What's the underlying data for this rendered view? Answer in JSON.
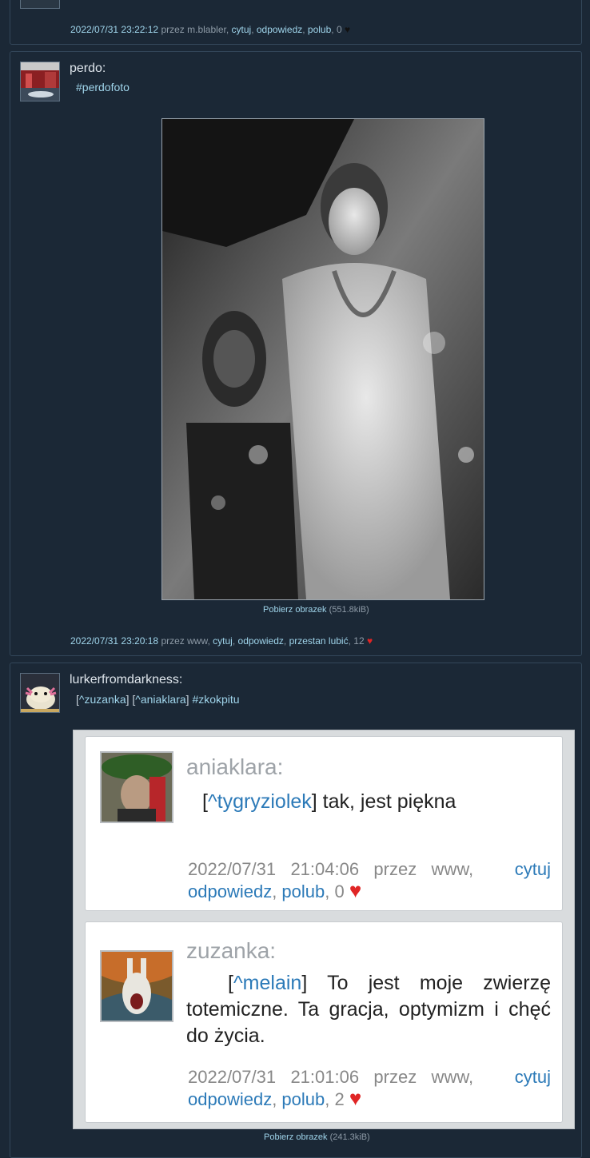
{
  "post0": {
    "timestamp": "2022/07/31 23:22:12",
    "via_prefix": "przez",
    "via": "m.blabler",
    "quote": "cytuj",
    "reply": "odpowiedz",
    "like": "polub",
    "likes": "0",
    "heart": "♥"
  },
  "post1": {
    "author": "perdo:",
    "tag": "#perdofoto",
    "download_label": "Pobierz obrazek",
    "download_size": "(551.8kiB)",
    "timestamp": "2022/07/31 23:20:18",
    "via_prefix": "przez",
    "via": "www",
    "quote": "cytuj",
    "reply": "odpowiedz",
    "unlike": "przestan lubić",
    "likes": "12",
    "heart": "♥"
  },
  "post2": {
    "author": "lurkerfromdarkness:",
    "mention1": "^zuzanka",
    "mention2": "^aniaklara",
    "tag": "#zkokpitu",
    "download_label": "Pobierz obrazek",
    "download_size": "(241.3kiB)",
    "cards": [
      {
        "author": "aniaklara:",
        "mention": "^tygryziolek",
        "text": " tak, jest piękna",
        "meta_prefix": "2022/07/31   21:04:06   przez   www,",
        "quote": "cytuj",
        "reply": "odpowiedz",
        "like": "polub",
        "likes": "0",
        "heart": "♥"
      },
      {
        "author": "zuzanka:",
        "mention": "^melain",
        "text": " To jest moje zwierzę totemiczne. Ta gracja, optymizm i chęć do życia.",
        "meta_prefix": "2022/07/31   21:01:06   przez   www,",
        "quote": "cytuj",
        "reply": "odpowiedz",
        "like": "polub",
        "likes": "2",
        "heart": "♥"
      }
    ]
  },
  "colors": {
    "background": "#1b2836",
    "link": "#9fd4ea",
    "heart_red": "#e02525",
    "border": "#33475a"
  }
}
